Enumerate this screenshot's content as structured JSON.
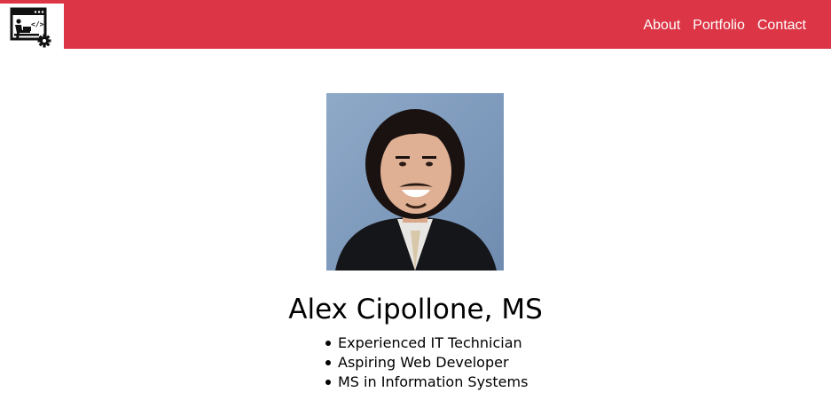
{
  "nav": {
    "logo_icon": "developer-workstation-gear-icon",
    "links": [
      "About",
      "Portfolio",
      "Contact"
    ],
    "background_color": "#dc3545",
    "link_color": "#ffffff"
  },
  "profile": {
    "photo": "profile-photo",
    "name": "Alex Cipollone, MS",
    "highlights": [
      "Experienced IT Technician",
      "Aspiring Web Developer",
      "MS in Information Systems"
    ]
  }
}
